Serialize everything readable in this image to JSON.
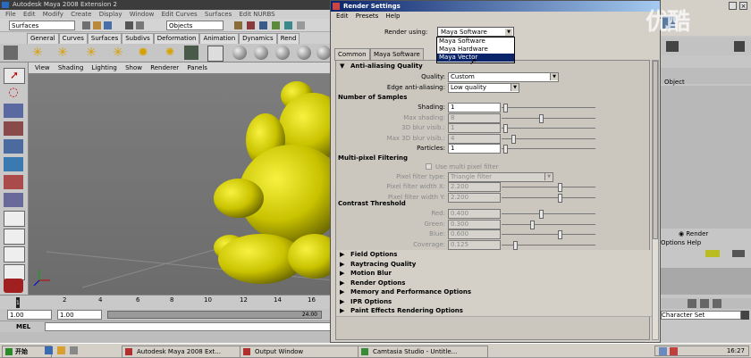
{
  "maya": {
    "title": "Autodesk Maya 2008 Extension 2",
    "menus": [
      "File",
      "Edit",
      "Modify",
      "Create",
      "Display",
      "Window",
      "Edit Curves",
      "Surfaces",
      "Edit NURBS"
    ],
    "menuset": "Surfaces",
    "objects_field": "Objects",
    "shelf_tabs": [
      "General",
      "Curves",
      "Surfaces",
      "Subdivs",
      "Deformation",
      "Animation",
      "Dynamics",
      "Rend"
    ],
    "panel_menus": [
      "View",
      "Shading",
      "Lighting",
      "Show",
      "Renderer",
      "Panels"
    ],
    "timeline_ticks": [
      "2",
      "4",
      "6",
      "8",
      "10",
      "12",
      "14",
      "16",
      "18"
    ],
    "current_frame": "1",
    "range_start": "1.00",
    "range_start2": "1.00",
    "range_end": "24.00",
    "cmd_label": "MEL"
  },
  "render_settings": {
    "title": "Render Settings",
    "menus": [
      "Edit",
      "Presets",
      "Help"
    ],
    "render_using_label": "Render using:",
    "render_using_value": "Maya Software",
    "dropdown_options": [
      "Maya Software",
      "Maya Hardware",
      "Maya Vector"
    ],
    "dropdown_selected": "Maya Vector",
    "tabs": [
      "Common",
      "Maya Software"
    ],
    "antialias": {
      "header": "Anti-aliasing Quality",
      "quality_label": "Quality:",
      "quality_value": "Custom",
      "edge_label": "Edge anti-aliasing:",
      "edge_value": "Low quality"
    },
    "samples": {
      "header": "Number of Samples",
      "rows": [
        {
          "label": "Shading:",
          "value": "1",
          "level": 0.02,
          "enabled": true
        },
        {
          "label": "Max shading:",
          "value": "8",
          "level": 0.4,
          "enabled": false
        },
        {
          "label": "3D blur visib.:",
          "value": "1",
          "level": 0.02,
          "enabled": false
        },
        {
          "label": "Max 3D blur visib.:",
          "value": "4",
          "level": 0.1,
          "enabled": false
        },
        {
          "label": "Particles:",
          "value": "1",
          "level": 0.02,
          "enabled": true
        }
      ]
    },
    "multipixel": {
      "header": "Multi-pixel Filtering",
      "checkbox_label": "Use multi pixel filter",
      "filter_type_label": "Pixel filter type:",
      "filter_type_value": "Triangle filter",
      "rows": [
        {
          "label": "Pixel filter width X:",
          "value": "2.200",
          "level": 0.6
        },
        {
          "label": "Pixel filter width Y:",
          "value": "2.200",
          "level": 0.6
        }
      ]
    },
    "contrast": {
      "header": "Contrast Threshold",
      "rows": [
        {
          "label": "Red:",
          "value": "0.400",
          "level": 0.4
        },
        {
          "label": "Green:",
          "value": "0.300",
          "level": 0.3
        },
        {
          "label": "Blue:",
          "value": "0.600",
          "level": 0.6
        },
        {
          "label": "Coverage:",
          "value": "0.125",
          "level": 0.12
        }
      ]
    },
    "collapsed_sections": [
      "Field Options",
      "Raytracing Quality",
      "Motion Blur",
      "Render Options",
      "Memory and Performance Options",
      "IPR Options",
      "Paint Effects Rendering Options"
    ]
  },
  "right_panel": {
    "object_label": "Object",
    "render_label": "Render",
    "options_label": "Options  Help",
    "character_set": "Character Set"
  },
  "taskbar": {
    "start": "开始",
    "tasks": [
      "Autodesk Maya 2008 Ext...",
      "Output Window",
      "Camtasia Studio - Untitle..."
    ],
    "clock": "16:27"
  },
  "watermark": "优酷"
}
